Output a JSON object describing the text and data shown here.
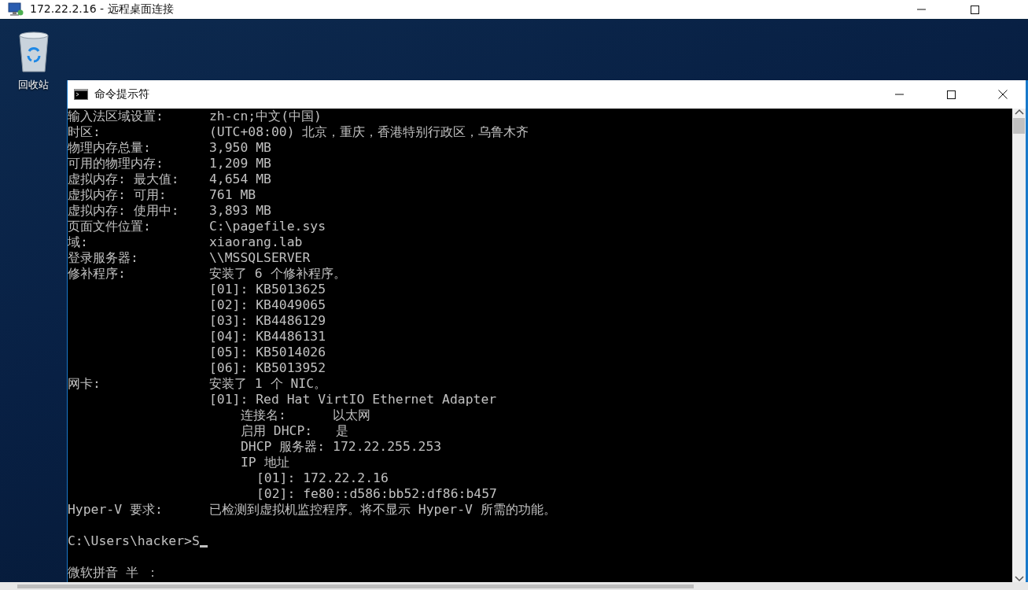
{
  "rdp_window": {
    "title": "172.22.2.16 - 远程桌面连接"
  },
  "desktop": {
    "icons": [
      {
        "label": "回收站"
      }
    ]
  },
  "cmd_window": {
    "title": "命令提示符",
    "lines": [
      {
        "kind": "field",
        "label": "输入法区域设置:",
        "value": "zh-cn;中文(中国)"
      },
      {
        "kind": "field",
        "label": "时区:",
        "value": "(UTC+08:00) 北京，重庆，香港特别行政区，乌鲁木齐"
      },
      {
        "kind": "field",
        "label": "物理内存总量:",
        "value": "3,950 MB"
      },
      {
        "kind": "field",
        "label": "可用的物理内存:",
        "value": "1,209 MB"
      },
      {
        "kind": "field",
        "label": "虚拟内存: 最大值:",
        "value": "4,654 MB"
      },
      {
        "kind": "field",
        "label": "虚拟内存: 可用:",
        "value": "761 MB"
      },
      {
        "kind": "field",
        "label": "虚拟内存: 使用中:",
        "value": "3,893 MB"
      },
      {
        "kind": "field",
        "label": "页面文件位置:",
        "value": "C:\\pagefile.sys"
      },
      {
        "kind": "field",
        "label": "域:",
        "value": "xiaorang.lab"
      },
      {
        "kind": "field",
        "label": "登录服务器:",
        "value": "\\\\MSSQLSERVER"
      },
      {
        "kind": "field",
        "label": "修补程序:",
        "value": "安装了 6 个修补程序。"
      },
      {
        "kind": "field",
        "value": "[01]: KB5013625"
      },
      {
        "kind": "field",
        "value": "[02]: KB4049065"
      },
      {
        "kind": "field",
        "value": "[03]: KB4486129"
      },
      {
        "kind": "field",
        "value": "[04]: KB4486131"
      },
      {
        "kind": "field",
        "value": "[05]: KB5014026"
      },
      {
        "kind": "field",
        "value": "[06]: KB5013952"
      },
      {
        "kind": "field",
        "label": "网卡:",
        "value": "安装了 1 个 NIC。"
      },
      {
        "kind": "field",
        "value": "[01]: Red Hat VirtIO Ethernet Adapter",
        "children": [
          {
            "text": "连接名:      以太网"
          },
          {
            "text": "启用 DHCP:   是"
          },
          {
            "text": "DHCP 服务器: 172.22.255.253"
          },
          {
            "text": "IP 地址",
            "children": [
              {
                "text": "[01]: 172.22.2.16"
              },
              {
                "text": "[02]: fe80::d586:bb52:df86:b457"
              }
            ]
          }
        ]
      },
      {
        "kind": "field",
        "label": "Hyper-V 要求:",
        "value": "已检测到虚拟机监控程序。将不显示 Hyper-V 所需的功能。"
      },
      {
        "kind": "blank"
      },
      {
        "kind": "prompt",
        "text": "C:\\Users\\hacker>S",
        "cursor": true
      },
      {
        "kind": "blank"
      },
      {
        "kind": "ime",
        "text": "微软拼音 半 ："
      }
    ]
  }
}
